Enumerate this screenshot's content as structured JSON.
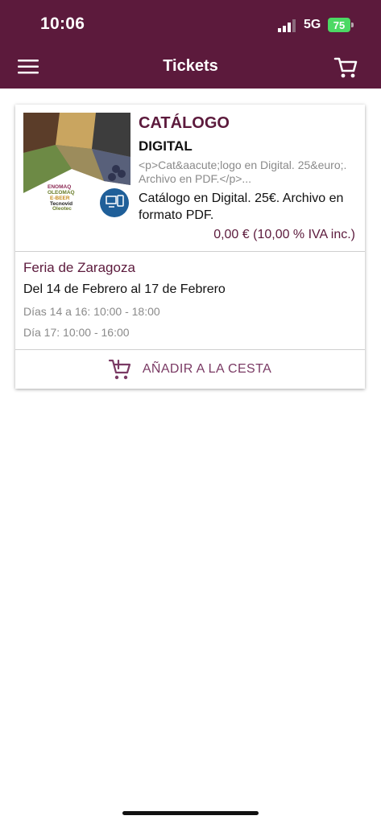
{
  "status_bar": {
    "time": "10:06",
    "network": "5G",
    "battery": "75"
  },
  "app_bar": {
    "title": "Tickets",
    "menu_icon": "hamburger-menu-icon",
    "cart_icon": "shopping-cart-icon"
  },
  "colors": {
    "primary": "#5c1a3c",
    "accent_text": "#7a3a64"
  },
  "product": {
    "title_line1": "CATÁLOGO",
    "title_line2": "DIGITAL",
    "raw_description": "<p>Cat&aacute;logo en Digital. 25&euro;. Archivo en PDF.</p>...",
    "description": "Catálogo en Digital. 25€. Archivo en formato PDF.",
    "price": "0,00 € (10,00 % IVA inc.)",
    "image_brand_lines": [
      "ENOMAQ",
      "OLEOMAQ",
      "E-BEER",
      "Tecnovid",
      "Oleotec"
    ]
  },
  "event": {
    "venue": "Feria de Zaragoza",
    "dates": "Del 14 de Febrero al 17 de Febrero",
    "hours_1": "Días 14 a 16:  10:00 - 18:00",
    "hours_2": "Día 17: 10:00 - 16:00"
  },
  "actions": {
    "add_to_cart": "AÑADIR A LA CESTA"
  }
}
